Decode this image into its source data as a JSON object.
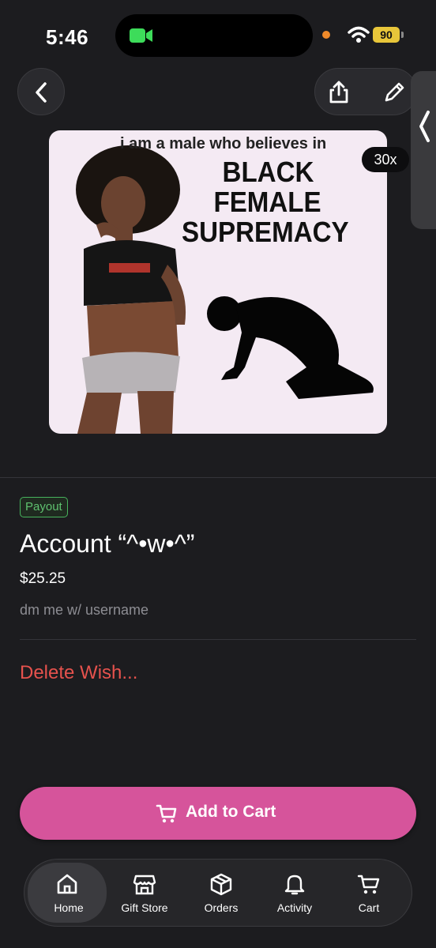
{
  "status_bar": {
    "time": "5:46",
    "battery": "90"
  },
  "product": {
    "quantity_badge": "30x",
    "image": {
      "caption_line1": "i am a male who believes in",
      "caption_big": [
        "BLACK",
        "FEMALE",
        "SUPREMACY"
      ]
    },
    "category_badge": "Payout",
    "title": "Account “^•w•^”",
    "price": "$25.25",
    "note": "dm me w/ username",
    "delete_label": "Delete Wish..."
  },
  "actions": {
    "add_to_cart": "Add to Cart"
  },
  "tabs": [
    {
      "label": "Home",
      "icon": "home-icon",
      "active": true
    },
    {
      "label": "Gift Store",
      "icon": "store-icon",
      "active": false
    },
    {
      "label": "Orders",
      "icon": "box-icon",
      "active": false
    },
    {
      "label": "Activity",
      "icon": "bell-icon",
      "active": false
    },
    {
      "label": "Cart",
      "icon": "cart-icon",
      "active": false
    }
  ],
  "colors": {
    "background": "#1c1c1f",
    "accent_pink": "#d6549b",
    "payout_green": "#5fc16f",
    "delete_red": "#e6524d"
  }
}
